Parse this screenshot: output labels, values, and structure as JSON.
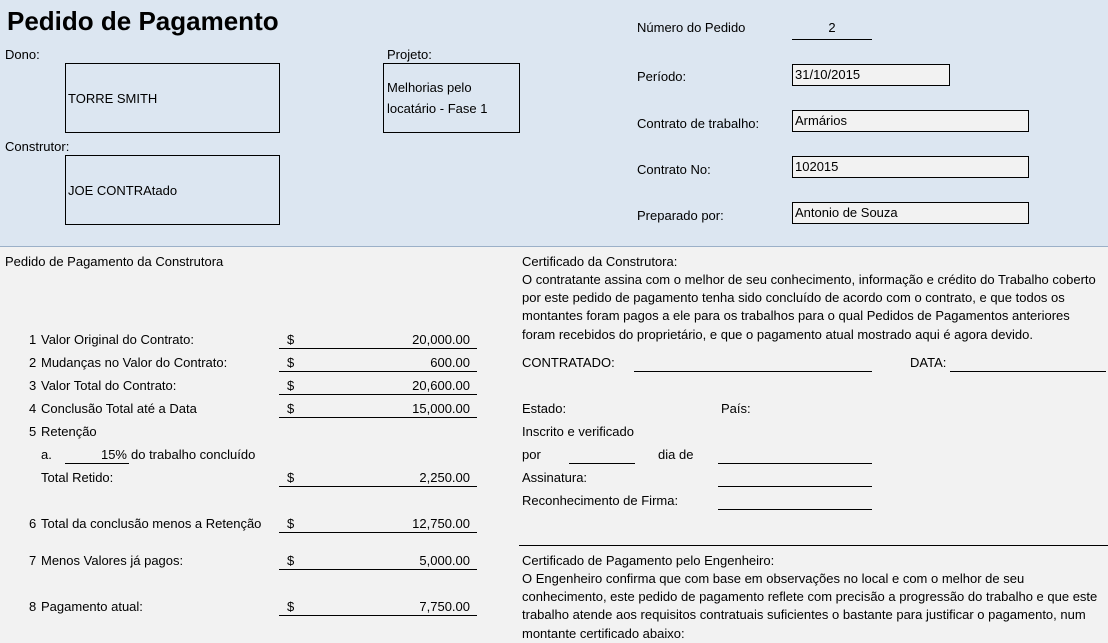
{
  "header": {
    "title": "Pedido de Pagamento",
    "owner_label": "Dono:",
    "owner_value": "TORRE SMITH",
    "project_label": "Projeto:",
    "project_value_line1": "Melhorias pelo",
    "project_value_line2": "locatário - Fase 1",
    "builder_label": "Construtor:",
    "builder_value": "JOE CONTRAtado",
    "order_number_label": "Número do Pedido",
    "order_number_value": "2",
    "period_label": "Período:",
    "period_value": "31/10/2015",
    "work_contract_label": "Contrato de trabalho:",
    "work_contract_value": "Armários",
    "contract_no_label": "Contrato No:",
    "contract_no_value": "102015",
    "prepared_by_label": "Preparado por:",
    "prepared_by_value": "Antonio de Souza"
  },
  "request": {
    "section_title": "Pedido de Pagamento da Construtora",
    "currency": "$",
    "items": [
      {
        "num": "1",
        "label": "Valor Original do Contrato:",
        "value": "20,000.00"
      },
      {
        "num": "2",
        "label": "Mudanças no Valor do Contrato:",
        "value": "600.00"
      },
      {
        "num": "3",
        "label": "Valor Total do Contrato:",
        "value": "20,600.00"
      },
      {
        "num": "4",
        "label": "Conclusão Total até a Data",
        "value": "15,000.00"
      }
    ],
    "retention_num": "5",
    "retention_label": "Retenção",
    "retention_a_label": "a.",
    "retention_pct": "15%",
    "retention_a_suffix": "do trabalho concluído",
    "total_retained_label": "Total Retido:",
    "total_retained_value": "2,250.00",
    "item6_num": "6",
    "item6_label": "Total da conclusão menos a Retenção",
    "item6_value": "12,750.00",
    "item7_num": "7",
    "item7_label": "Menos Valores já pagos:",
    "item7_value": "5,000.00",
    "item8_num": "8",
    "item8_label": "Pagamento atual:",
    "item8_value": "7,750.00"
  },
  "certificate": {
    "title": "Certificado da Construtora:",
    "body": "O contratante assina com o melhor de seu conhecimento, informação e crédito do Trabalho coberto por este pedido de pagamento tenha sido concluído de acordo com o contrato, e que todos os montantes foram pagos a ele para os trabalhos para o qual Pedidos de Pagamentos anteriores foram recebidos do proprietário, e que o pagamento atual mostrado aqui é agora devido.",
    "contracted_label": "CONTRATADO:",
    "date_label": "DATA:",
    "state_label": "Estado:",
    "country_label": "País:",
    "registered_label": "Inscrito e verificado",
    "by_label": "por",
    "day_of_label": "dia de",
    "signature_label": "Assinatura:",
    "notary_label": "Reconhecimento de Firma:"
  },
  "engineer": {
    "title": "Certificado de Pagamento pelo Engenheiro:",
    "body": "O Engenheiro confirma que com base em observações no local e com o melhor de seu conhecimento, este pedido de pagamento reflete com precisão a progressão do trabalho e que este trabalho atende aos requisitos contratuais suficientes o bastante para justificar o pagamento, num montante certificado abaixo:"
  }
}
